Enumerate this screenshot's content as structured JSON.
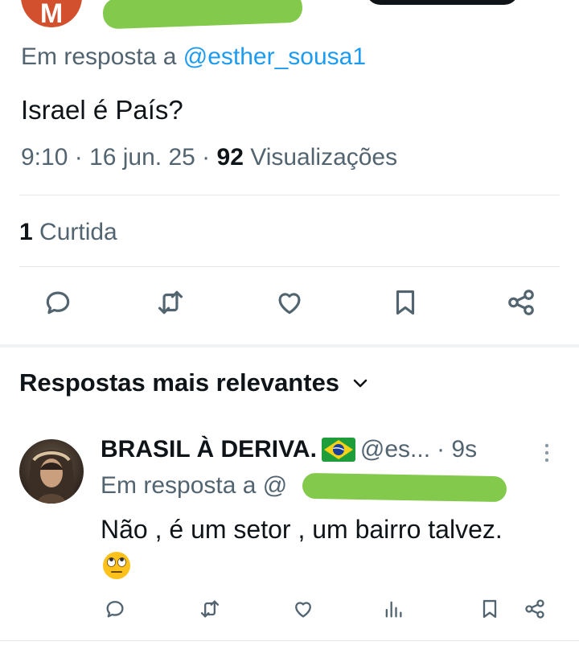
{
  "original_tweet": {
    "author_initial": "M",
    "reply_to_prefix": "Em resposta a",
    "reply_to_handle": "@esther_sousa1",
    "text": "Israel é País?",
    "time": "9:10",
    "date": "16 jun. 25",
    "views_count": "92",
    "views_label": "Visualizações",
    "likes_count": "1",
    "likes_label": "Curtida"
  },
  "actions": {
    "main": [
      "reply-icon",
      "retweet-icon",
      "like-icon",
      "bookmark-icon",
      "share-icon"
    ],
    "reply": [
      "reply-icon",
      "retweet-icon",
      "like-icon",
      "views-icon",
      "bookmark-icon",
      "share-icon"
    ]
  },
  "replies_section": {
    "title": "Respostas mais relevantes",
    "icon": "chevron-down-icon"
  },
  "reply": {
    "author_name": "BRASIL À DERIVA.",
    "flag_icon": "brazil-flag-icon",
    "handle": "@es...",
    "time": "· 9s",
    "reply_to_prefix": "Em resposta a @",
    "text": "Não , é um setor , um bairro talvez.",
    "emoji": "face-with-rolling-eyes-icon"
  },
  "colors": {
    "accent": "#1d9bf0",
    "muted_text": "#536471",
    "primary_text": "#0f1419",
    "redaction": "#82c94c",
    "avatar_m": "#d2502e"
  }
}
